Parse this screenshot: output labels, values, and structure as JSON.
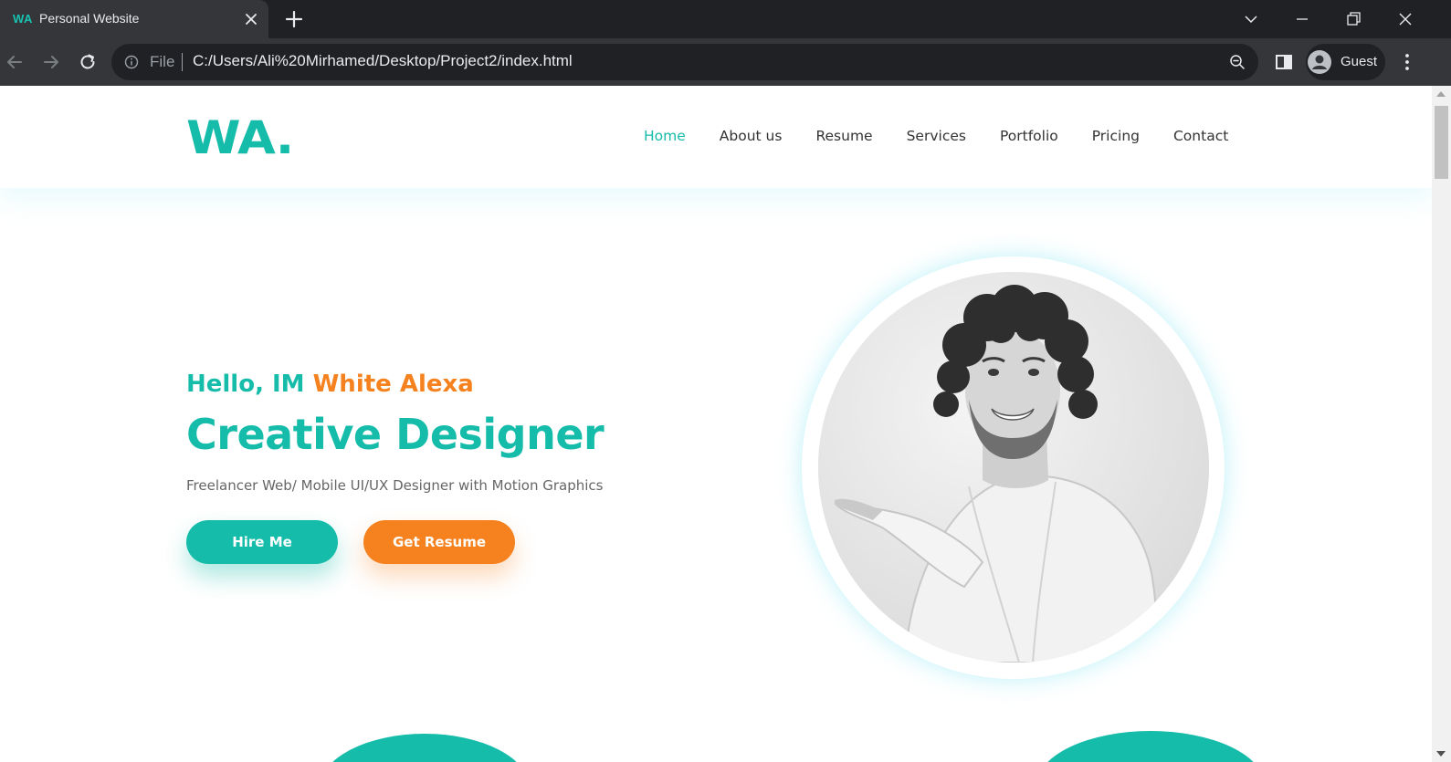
{
  "browser": {
    "tab_title": "Personal Website",
    "tab_favicon_text": "WA",
    "address_scheme": "File",
    "address_url": "C:/Users/Ali%20Mirhamed/Desktop/Project2/index.html",
    "profile_label": "Guest"
  },
  "site": {
    "logo": "WA.",
    "nav": [
      {
        "label": "Home",
        "active": true
      },
      {
        "label": "About us",
        "active": false
      },
      {
        "label": "Resume",
        "active": false
      },
      {
        "label": "Services",
        "active": false
      },
      {
        "label": "Portfolio",
        "active": false
      },
      {
        "label": "Pricing",
        "active": false
      },
      {
        "label": "Contact",
        "active": false
      }
    ],
    "hero": {
      "greeting": "Hello, IM",
      "name": "White Alexa",
      "title": "Creative Designer",
      "subtitle": "Freelancer Web/ Mobile UI/UX Designer with Motion Graphics",
      "hire_button": "Hire Me",
      "resume_button": "Get Resume"
    }
  },
  "colors": {
    "brand_teal": "#16bcaa",
    "accent_orange": "#f5821f",
    "chrome_dark": "#202124",
    "chrome_mid": "#35363a"
  }
}
